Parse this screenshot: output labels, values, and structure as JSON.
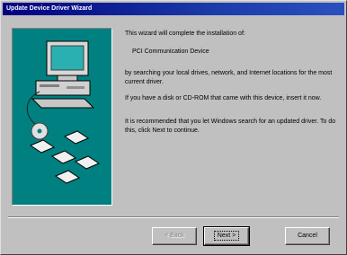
{
  "window": {
    "title": "Update Device Driver Wizard"
  },
  "content": {
    "intro": "This wizard will complete the installation of:",
    "device": "PCI Communication Device",
    "para1": "by searching your local drives, network, and Internet locations for the most current driver.",
    "para2": "If you have a disk or CD-ROM that came with this device, insert it now.",
    "para3": "It is recommended that you let Windows search for an updated driver. To do this, click Next to continue."
  },
  "buttons": {
    "back": "< Back",
    "next": "Next >",
    "cancel": "Cancel"
  },
  "colors": {
    "title_bar": "#000080",
    "art_background": "#008080",
    "face": "#c0c0c0"
  }
}
